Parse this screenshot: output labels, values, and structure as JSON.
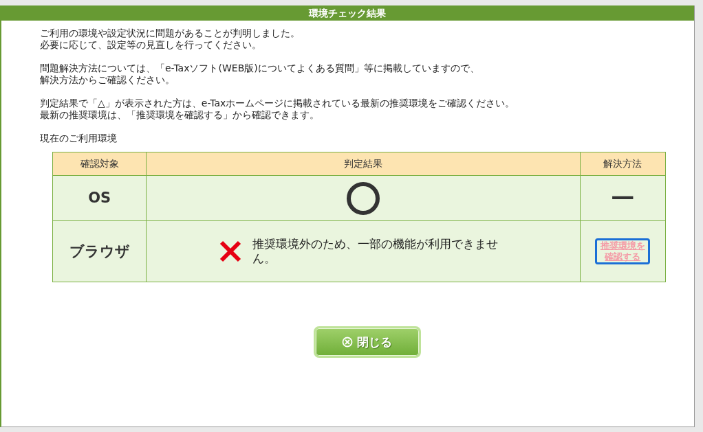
{
  "window": {
    "title": "環境チェック結果"
  },
  "paragraphs": [
    [
      "ご利用の環境や設定状況に問題があることが判明しました。",
      "必要に応じて、設定等の見直しを行ってください。"
    ],
    [
      "問題解決方法については、「e-Taxソフト(WEB版)についてよくある質問」等に掲載していますので、",
      "解決方法からご確認ください。"
    ],
    [
      "判定結果で「△」が表示された方は、e-Taxホームページに掲載されている最新の推奨環境をご確認ください。",
      "最新の推奨環境は、「推奨環境を確認する」から確認できます。"
    ]
  ],
  "section_title": "現在のご利用環境",
  "table": {
    "columns": [
      "確認対象",
      "判定結果",
      "解決方法"
    ],
    "rows": [
      {
        "target": "OS",
        "result": {
          "kind": "ok"
        },
        "solution": {
          "kind": "none",
          "text": "—"
        }
      },
      {
        "target": "ブラウザ",
        "result": {
          "kind": "ng",
          "message": "推奨環境外のため、一部の機能が利用できません。"
        },
        "solution": {
          "kind": "link",
          "text": "推奨環境を確認する",
          "focused": true
        }
      }
    ]
  },
  "buttons": [
    {
      "label": "閉じる"
    }
  ]
}
